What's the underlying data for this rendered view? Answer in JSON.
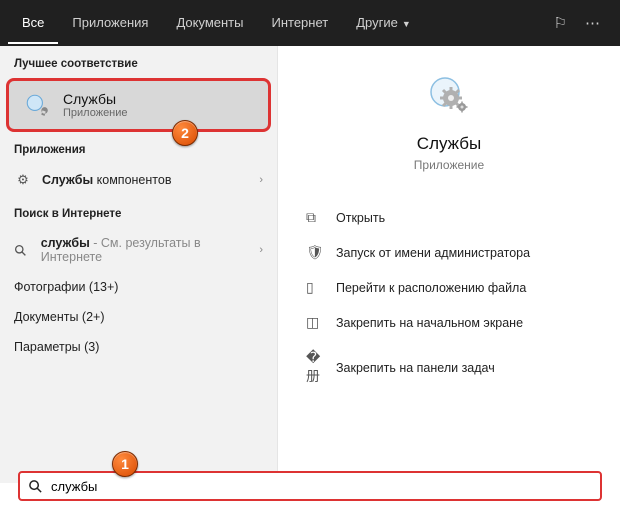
{
  "topbar": {
    "tabs": {
      "all": "Все",
      "apps": "Приложения",
      "docs": "Документы",
      "web": "Интернет",
      "more": "Другие"
    }
  },
  "left": {
    "best_match": "Лучшее соответствие",
    "hero": {
      "title": "Службы",
      "subtitle": "Приложение"
    },
    "apps_label": "Приложения",
    "app_row_prefix": "Службы",
    "app_row_suffix": " компонентов",
    "web_label": "Поиск в Интернете",
    "web_row_prefix": "службы",
    "web_row_suffix": " - См. результаты в Интернете",
    "photos": "Фотографии (13+)",
    "documents": "Документы (2+)",
    "params": "Параметры (3)"
  },
  "right": {
    "title": "Службы",
    "subtitle": "Приложение",
    "actions": {
      "open": "Открыть",
      "admin": "Запуск от имени администратора",
      "location": "Перейти к расположению файла",
      "pin_start": "Закрепить на начальном экране",
      "pin_taskbar": "Закрепить на панели задач"
    }
  },
  "search": {
    "value": "службы"
  },
  "badges": {
    "one": "1",
    "two": "2"
  }
}
